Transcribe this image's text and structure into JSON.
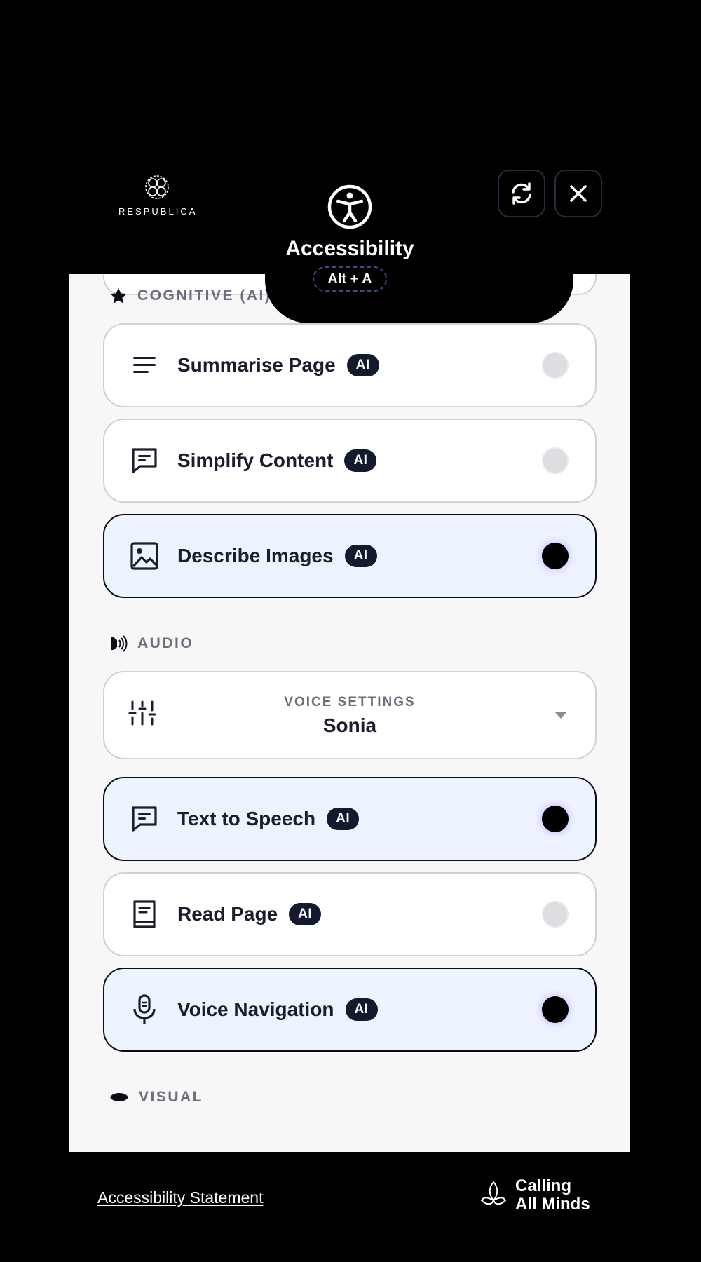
{
  "header": {
    "brand": "RESPUBLICA",
    "title": "Accessibility",
    "shortcut": "Alt + A",
    "reset_icon": "refresh-icon",
    "close_icon": "close-icon"
  },
  "sections": {
    "cognitive": {
      "title": "COGNITIVE (AI)",
      "icon": "star-icon"
    },
    "audio": {
      "title": "AUDIO",
      "icon": "speaker-icon"
    },
    "visual": {
      "title": "VISUAL",
      "icon": "eye-icon"
    }
  },
  "cognitive_items": [
    {
      "label": "Summarise Page",
      "badge": "AI",
      "icon": "list-icon",
      "enabled": false
    },
    {
      "label": "Simplify Content",
      "badge": "AI",
      "icon": "message-icon",
      "enabled": false
    },
    {
      "label": "Describe Images",
      "badge": "AI",
      "icon": "image-icon",
      "enabled": true
    }
  ],
  "voice_settings": {
    "caption": "VOICE SETTINGS",
    "value": "Sonia",
    "icon": "sliders-icon"
  },
  "audio_items": [
    {
      "label": "Text to Speech",
      "badge": "AI",
      "icon": "message-icon",
      "enabled": true
    },
    {
      "label": "Read Page",
      "badge": "AI",
      "icon": "book-icon",
      "enabled": false
    },
    {
      "label": "Voice Navigation",
      "badge": "AI",
      "icon": "microphone-icon",
      "enabled": true
    }
  ],
  "footer": {
    "statement_link": "Accessibility Statement",
    "partner_line1": "Calling",
    "partner_line2": "All Minds"
  },
  "colors": {
    "panel_bg": "#f7f7f8",
    "active_card_bg": "#eef4ff",
    "badge_bg": "#141a2e",
    "section_text": "#6b6f7b"
  }
}
